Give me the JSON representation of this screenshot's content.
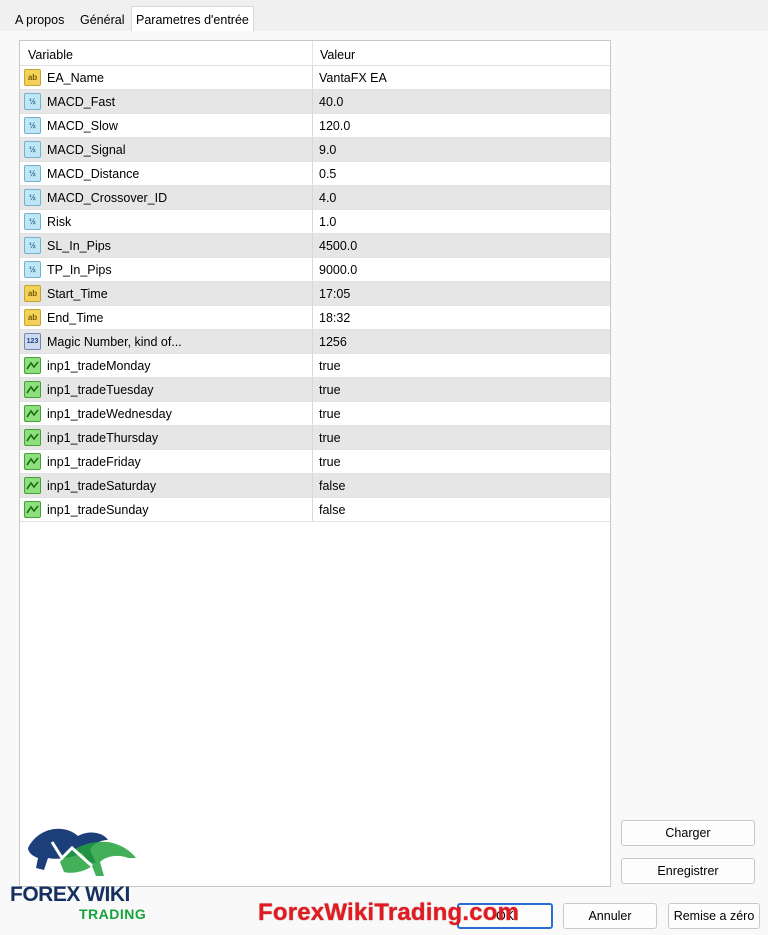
{
  "tabs": [
    {
      "label": "A propos"
    },
    {
      "label": "Général"
    },
    {
      "label": "Parametres d'entrée",
      "active": true
    }
  ],
  "grid": {
    "col_variable": "Variable",
    "col_value": "Valeur",
    "rows": [
      {
        "icon": "string-icon",
        "type": "string",
        "name": "EA_Name",
        "value": "VantaFX EA"
      },
      {
        "icon": "double-icon",
        "type": "double",
        "name": "MACD_Fast",
        "value": "40.0"
      },
      {
        "icon": "double-icon",
        "type": "double",
        "name": "MACD_Slow",
        "value": "120.0"
      },
      {
        "icon": "double-icon",
        "type": "double",
        "name": "MACD_Signal",
        "value": "9.0"
      },
      {
        "icon": "double-icon",
        "type": "double",
        "name": "MACD_Distance",
        "value": "0.5"
      },
      {
        "icon": "double-icon",
        "type": "double",
        "name": "MACD_Crossover_ID",
        "value": "4.0"
      },
      {
        "icon": "double-icon",
        "type": "double",
        "name": "Risk",
        "value": "1.0"
      },
      {
        "icon": "double-icon",
        "type": "double",
        "name": "SL_In_Pips",
        "value": "4500.0"
      },
      {
        "icon": "double-icon",
        "type": "double",
        "name": "TP_In_Pips",
        "value": "9000.0"
      },
      {
        "icon": "string-icon",
        "type": "string",
        "name": "Start_Time",
        "value": "17:05"
      },
      {
        "icon": "string-icon",
        "type": "string",
        "name": "End_Time",
        "value": "18:32"
      },
      {
        "icon": "integer-icon",
        "type": "int",
        "name": "Magic Number, kind of...",
        "value": "1256"
      },
      {
        "icon": "bool-icon",
        "type": "bool",
        "name": "inp1_tradeMonday",
        "value": "true"
      },
      {
        "icon": "bool-icon",
        "type": "bool",
        "name": "inp1_tradeTuesday",
        "value": "true"
      },
      {
        "icon": "bool-icon",
        "type": "bool",
        "name": "inp1_tradeWednesday",
        "value": "true"
      },
      {
        "icon": "bool-icon",
        "type": "bool",
        "name": "inp1_tradeThursday",
        "value": "true"
      },
      {
        "icon": "bool-icon",
        "type": "bool",
        "name": "inp1_tradeFriday",
        "value": "true"
      },
      {
        "icon": "bool-icon",
        "type": "bool",
        "name": "inp1_tradeSaturday",
        "value": "false"
      },
      {
        "icon": "bool-icon",
        "type": "bool",
        "name": "inp1_tradeSunday",
        "value": "false"
      }
    ]
  },
  "icon_labels": {
    "string": "ab",
    "double": "½",
    "int": "123"
  },
  "buttons": {
    "load": "Charger",
    "save": "Enregistrer",
    "ok": "OK",
    "cancel": "Annuler",
    "reset": "Remise a zéro"
  },
  "watermark": "ForexWikiTrading.com",
  "logo": {
    "main": "FOREX WIKI",
    "sub": "TRADING"
  },
  "colors": {
    "accent": "#2a6fcf",
    "watermark": "#e11b22",
    "logo_blue": "#15305f",
    "logo_green": "#17a33b"
  }
}
